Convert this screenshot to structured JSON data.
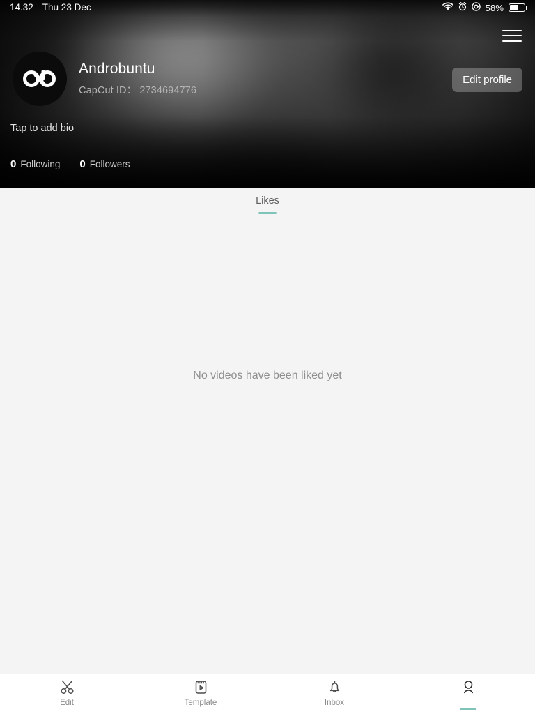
{
  "status_bar": {
    "time": "14.32",
    "date": "Thu 23 Dec",
    "battery_percent": "58%",
    "icons": [
      "wifi-icon",
      "alarm-icon",
      "do-not-disturb-icon",
      "battery-icon"
    ]
  },
  "header": {
    "menu_icon": "hamburger-menu-icon",
    "avatar_icon": "androbuntu-logo-avatar",
    "display_name": "Androbuntu",
    "capcut_id_label": "CapCut ID：",
    "capcut_id_value": "2734694776",
    "bio_placeholder": "Tap to add bio",
    "edit_profile_label": "Edit profile",
    "stats": [
      {
        "count": "0",
        "label": "Following"
      },
      {
        "count": "0",
        "label": "Followers"
      }
    ]
  },
  "tabs": [
    {
      "label": "Likes",
      "active": true
    }
  ],
  "content": {
    "empty_message": "No videos have been liked yet"
  },
  "bottom_nav": [
    {
      "label": "Edit",
      "icon": "scissors-icon",
      "active": false
    },
    {
      "label": "Template",
      "icon": "template-play-icon",
      "active": false
    },
    {
      "label": "Inbox",
      "icon": "bell-icon",
      "active": false
    },
    {
      "label": "",
      "icon": "person-icon",
      "active": true
    }
  ],
  "colors": {
    "accent_teal": "#7fc4b8",
    "body_background": "#f4f4f4",
    "nav_background": "#ffffff",
    "nav_label": "#8a8a8a",
    "empty_text": "#8e8e8e"
  }
}
